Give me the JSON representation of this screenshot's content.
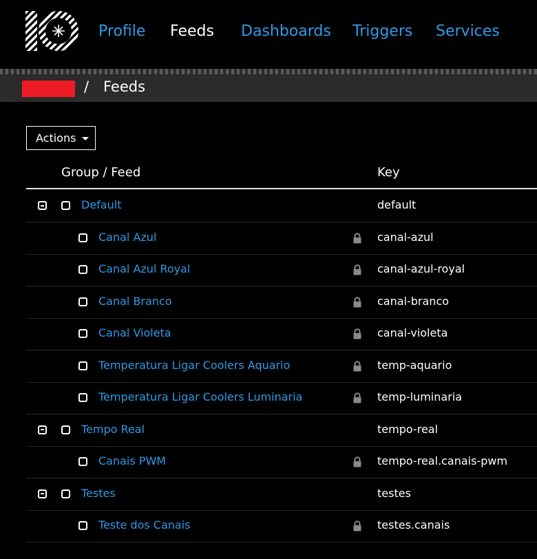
{
  "nav": {
    "items": [
      {
        "label": "Profile",
        "active": false
      },
      {
        "label": "Feeds",
        "active": true
      },
      {
        "label": "Dashboards",
        "active": false
      },
      {
        "label": "Triggers",
        "active": false
      },
      {
        "label": "Services",
        "active": false
      }
    ]
  },
  "breadcrumb": {
    "separator": "/",
    "page": "Feeds"
  },
  "toolbar": {
    "actions_label": "Actions"
  },
  "table": {
    "headers": {
      "group_feed": "Group / Feed",
      "key": "Key"
    },
    "rows": [
      {
        "type": "group",
        "name": "Default",
        "key": "default"
      },
      {
        "type": "feed",
        "name": "Canal Azul",
        "key": "canal-azul",
        "locked": true
      },
      {
        "type": "feed",
        "name": "Canal Azul Royal",
        "key": "canal-azul-royal",
        "locked": true
      },
      {
        "type": "feed",
        "name": "Canal Branco",
        "key": "canal-branco",
        "locked": true
      },
      {
        "type": "feed",
        "name": "Canal Violeta",
        "key": "canal-violeta",
        "locked": true
      },
      {
        "type": "feed",
        "name": "Temperatura Ligar Coolers Aquario",
        "key": "temp-aquario",
        "locked": true
      },
      {
        "type": "feed",
        "name": "Temperatura Ligar Coolers Luminaria",
        "key": "temp-luminaria",
        "locked": true
      },
      {
        "type": "group",
        "name": "Tempo Real",
        "key": "tempo-real"
      },
      {
        "type": "feed",
        "name": "Canais PWM",
        "key": "tempo-real.canais-pwm",
        "locked": true
      },
      {
        "type": "group",
        "name": "Testes",
        "key": "testes"
      },
      {
        "type": "feed",
        "name": "Teste dos Canais",
        "key": "testes.canais",
        "locked": true
      }
    ]
  },
  "colors": {
    "link": "#2E9BE6",
    "background": "#000000",
    "breadcrumb_user_block": "#ED1C24"
  },
  "icons": {
    "logo": "io-logo",
    "lock": "lock-icon",
    "collapse": "minus-square-icon",
    "checkbox": "checkbox-icon",
    "caret": "caret-down-icon"
  }
}
